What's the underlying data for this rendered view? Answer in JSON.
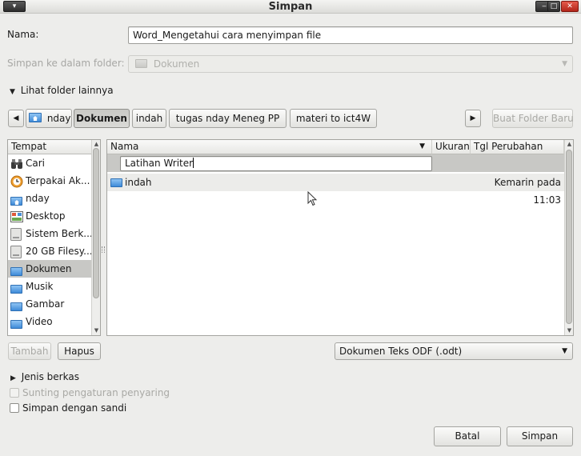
{
  "window": {
    "title": "Simpan"
  },
  "form": {
    "name_label": "Nama:",
    "name_value": "Word_Mengetahui cara menyimpan file",
    "folder_label": "Simpan ke dalam folder:",
    "folder_value": "Dokumen",
    "browse_toggle": "Lihat folder lainnya"
  },
  "pathbar": {
    "items": [
      "nday",
      "Dokumen",
      "indah",
      "tugas nday Meneg PP",
      "materi to ict4W"
    ],
    "active_index": 1,
    "create_folder_button": "Buat Folder Baru"
  },
  "places": {
    "header": "Tempat",
    "items": [
      {
        "label": "Cari",
        "icon": "binoculars-icon"
      },
      {
        "label": "Terpakai Ak...",
        "icon": "recent-clock-icon"
      },
      {
        "label": "nday",
        "icon": "home-folder-icon"
      },
      {
        "label": "Desktop",
        "icon": "desktop-icon"
      },
      {
        "label": "Sistem Berk...",
        "icon": "drive-icon"
      },
      {
        "label": "20 GB Filesy...",
        "icon": "drive-icon"
      },
      {
        "label": "Dokumen",
        "icon": "folder-icon"
      },
      {
        "label": "Musik",
        "icon": "folder-icon"
      },
      {
        "label": "Gambar",
        "icon": "folder-icon"
      },
      {
        "label": "Video",
        "icon": "folder-icon"
      }
    ],
    "selected_index": 6,
    "add_button": "Tambah",
    "remove_button": "Hapus"
  },
  "files": {
    "columns": {
      "name": "Nama",
      "size": "Ukuran",
      "modified": "Tgl Perubahan"
    },
    "new_folder_edit_value": "Latihan Writer",
    "rows": [
      {
        "name": "indah",
        "size": "",
        "modified": "Kemarin pada 11:03"
      }
    ]
  },
  "filter": {
    "selected": "Dokumen Teks ODF (.odt)"
  },
  "options": {
    "file_type_toggle": "Jenis berkas",
    "edit_filter_label": "Sunting pengaturan penyaring",
    "password_label": "Simpan dengan sandi"
  },
  "actions": {
    "cancel": "Batal",
    "save": "Simpan"
  },
  "colors": {
    "window_bg": "#ededeb",
    "selection": "#c8c8c5",
    "folder_blue": "#3f8bd8"
  }
}
